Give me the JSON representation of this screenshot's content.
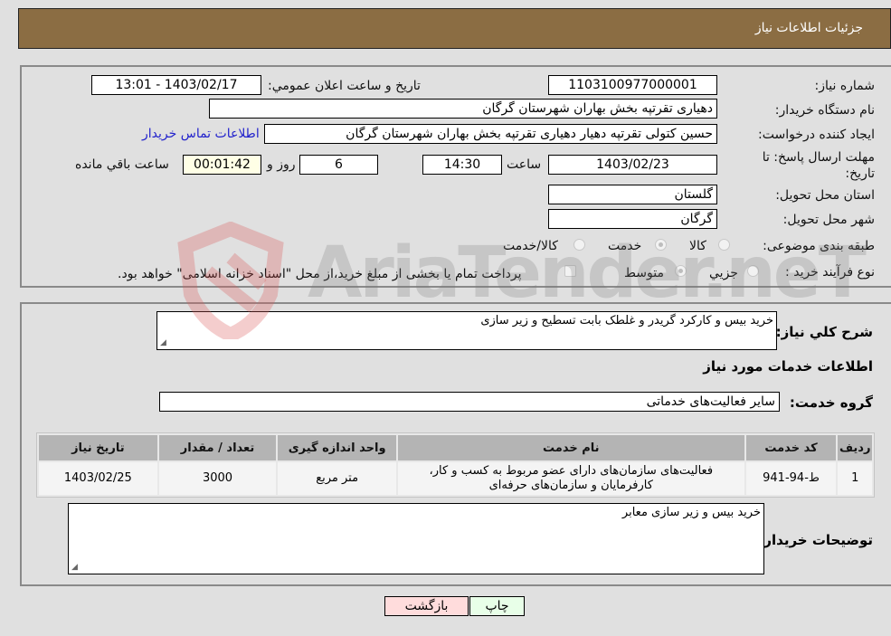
{
  "header": {
    "title": "جزئیات اطلاعات نیاز"
  },
  "details": {
    "need_number": {
      "label": "شماره نیاز:",
      "value": "1103100977000001"
    },
    "announce_datetime": {
      "label": "تاریخ و ساعت اعلان عمومي:",
      "value": "1403/02/17 - 13:01"
    },
    "buyer_org": {
      "label": "نام دستگاه خريدار:",
      "value": "دهیاری تقرتپه بخش بهاران شهرستان گرگان"
    },
    "requester": {
      "label": "ایجاد کننده درخواست:",
      "value": "حسین کتولی تقرتپه دهیار دهیاری تقرتپه بخش بهاران شهرستان گرگان"
    },
    "buyer_contact_link": "اطلاعات تماس خريدار",
    "deadline": {
      "label": "مهلت ارسال پاسخ: تا تاریخ:",
      "date": "1403/02/23",
      "time_label": "ساعت",
      "time": "14:30",
      "days": "6",
      "days_label": "روز و",
      "remaining": "00:01:42",
      "remaining_label": "ساعت باقي مانده"
    },
    "province": {
      "label": "استان محل تحویل:",
      "value": "گلستان"
    },
    "city": {
      "label": "شهر محل تحویل:",
      "value": "گرگان"
    },
    "category": {
      "label": "طبقه بندی موضوعی:",
      "options": [
        "کالا",
        "خدمت",
        "کالا/خدمت"
      ],
      "selected": "خدمت"
    },
    "process": {
      "label": "نوع فرآیند خرید :",
      "options": [
        "جزيي",
        "متوسط"
      ],
      "selected": "متوسط",
      "treasury_note": "پرداخت تمام یا بخشی از مبلغ خرید،از محل \"اسناد خزانه اسلامی\" خواهد بود."
    }
  },
  "summary": {
    "label": "شرح كلي نياز:",
    "value": "خرید بیس و کارکرد گریدر و غلطک بابت تسطیح و زیر سازی"
  },
  "services_section_title": "اطلاعات خدمات مورد نياز",
  "service_group": {
    "label": "گروه خدمت:",
    "value": "سایر فعالیت‌های خدماتی"
  },
  "table": {
    "headers": [
      "رديف",
      "كد خدمت",
      "نام خدمت",
      "واحد اندازه گيری",
      "تعداد / مقدار",
      "تاريخ نياز"
    ],
    "rows": [
      [
        "1",
        "ط-94-941",
        "فعالیت‌های سازمان‌های دارای عضو مربوط به کسب و کار، کارفرمایان و سازمان‌های حرفه‌ای",
        "متر مربع",
        "3000",
        "1403/02/25"
      ]
    ]
  },
  "buyer_notes": {
    "label": "توضيحات خريدار:",
    "value": "خرید بیس و زیر سازی معابر"
  },
  "buttons": {
    "print": "چاپ",
    "back": "بازگشت"
  },
  "watermark": "AriaTender.neT"
}
